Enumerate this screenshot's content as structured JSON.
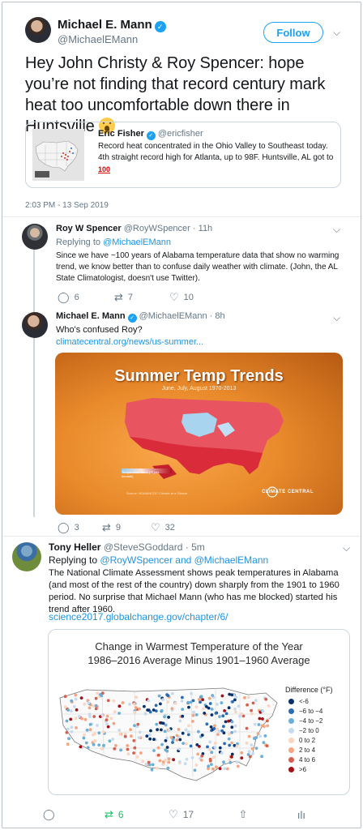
{
  "main_tweet": {
    "author_name": "Michael E. Mann",
    "author_handle": "@MichaelEMann",
    "follow_label": "Follow",
    "text": "Hey John Christy & Roy Spencer: hope you’re not finding that record century mark heat too uncomfortable down there in Huntsville",
    "emoji": "hushed-face-emoji",
    "timestamp": "2:03 PM - 13 Sep 2019",
    "quote": {
      "author_name": "Eric Fisher",
      "author_handle": "@ericfisher",
      "text": "Record heat concentrated in the Ohio Valley to Southeast today. 4th straight record high for Atlanta, up to 98F. Huntsville, AL got to",
      "badge": "100"
    }
  },
  "reply_spencer": {
    "author_name": "Roy W Spencer",
    "author_handle": "@RoyWSpencer",
    "time": "11h",
    "replying_prefix": "Replying to",
    "replying_to": "@MichaelEMann",
    "text": "Since we have ~100 years of Alabama temperature data that show no warming trend, we know better than to confuse daily weather with climate. (John, the AL State Climatologist, doesn't use Twitter).",
    "replies": "6",
    "retweets": "7",
    "likes": "10"
  },
  "reply_mann": {
    "author_name": "Michael E. Mann",
    "author_handle": "@MichaelEMann",
    "time": "8h",
    "text": "Who's confused Roy?",
    "link": "climatecentral.org/news/us-summer...",
    "image": {
      "title": "Summer Temp Trends",
      "subtitle": "June, July, August 1970-2013",
      "legend": "Temperature trend (°F per decade)",
      "logo": "CLIMATE CENTRAL",
      "source": "Source: NOAA/NCDC Climate at a Glance"
    },
    "replies": "3",
    "retweets": "9",
    "likes": "32"
  },
  "reply_heller": {
    "author_name": "Tony Heller",
    "author_handle": "@SteveSGoddard",
    "time": "5m",
    "replying_prefix": "Replying to",
    "replying_to": "@RoyWSpencer and @MichaelEMann",
    "text": "The National Climate Assessment shows peak temperatures in Alabama (and most of the rest of the country) down sharply from the 1901 to 1960 period. No surprise that Michael Mann (who has me blocked) started his trend after 1960.",
    "link": "science2017.globalchange.gov/chapter/6/",
    "chart": {
      "title_line1": "Change in Warmest Temperature of the Year",
      "title_line2": "1986–2016 Average Minus 1901–1960 Average",
      "legend_title": "Difference (°F)",
      "legend": [
        {
          "label": "<-6",
          "color": "#08306b"
        },
        {
          "label": "−6 to −4",
          "color": "#2b6cb0"
        },
        {
          "label": "−4 to −2",
          "color": "#6baed6"
        },
        {
          "label": "−2 to 0",
          "color": "#c6dbef"
        },
        {
          "label": "0 to 2",
          "color": "#fcd5c0"
        },
        {
          "label": "2 to 4",
          "color": "#f4a582"
        },
        {
          "label": "4 to 6",
          "color": "#d6604d"
        },
        {
          "label": ">6",
          "color": "#a50f15"
        }
      ]
    },
    "replies": "",
    "retweets": "6",
    "likes": "17"
  }
}
